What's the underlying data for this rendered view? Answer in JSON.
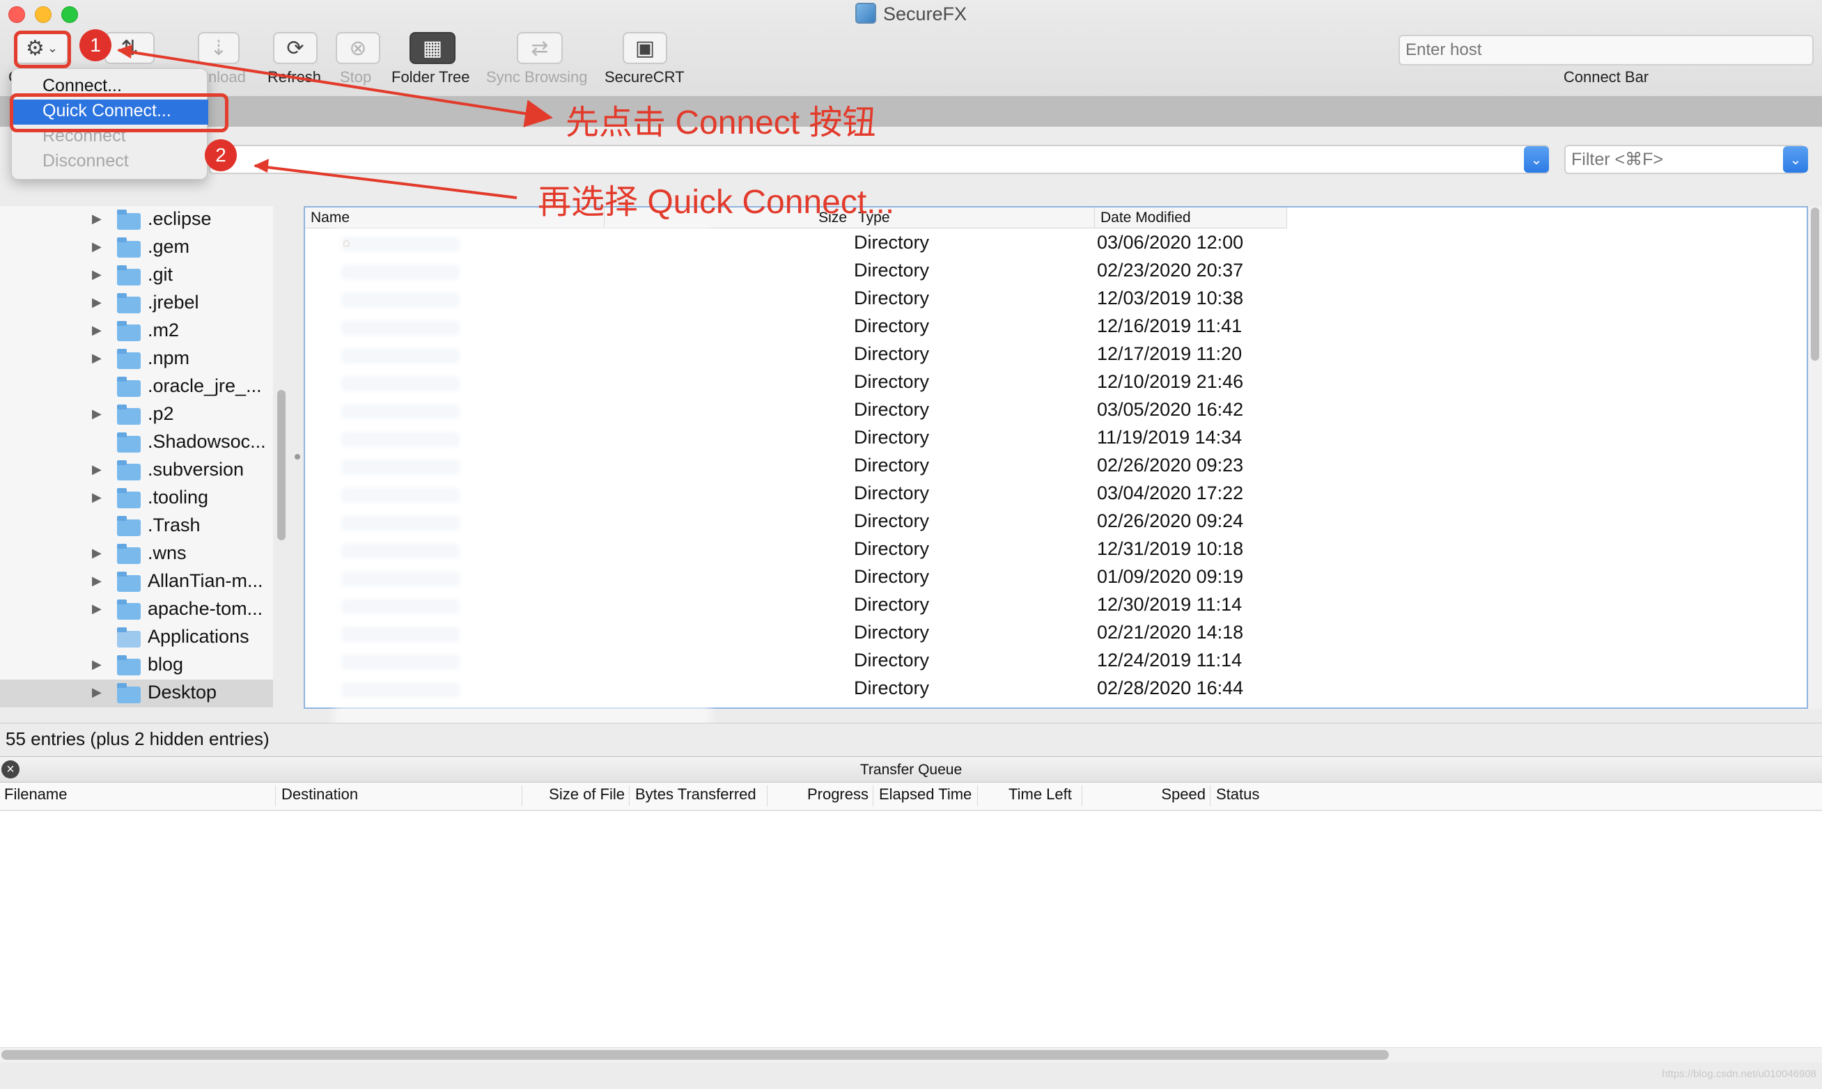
{
  "window": {
    "title": "SecureFX"
  },
  "toolbar": {
    "connect_partial_label": "C",
    "download_label": "Download",
    "download_partial": "vnload",
    "refresh_label": "Refresh",
    "stop_label": "Stop",
    "folder_tree_label": "Folder Tree",
    "sync_browsing_label": "Sync Browsing",
    "securecrt_label": "SecureCRT",
    "host_placeholder": "Enter host",
    "connect_bar_label": "Connect Bar"
  },
  "connect_menu": {
    "items": [
      {
        "label": "Connect...",
        "state": "normal"
      },
      {
        "label": "Quick Connect...",
        "state": "highlighted"
      },
      {
        "label": "Reconnect",
        "state": "disabled"
      },
      {
        "label": "Disconnect",
        "state": "disabled"
      }
    ]
  },
  "filter": {
    "placeholder": "Filter <⌘F>"
  },
  "annotations": {
    "badge1": "1",
    "badge2": "2",
    "step1_text": "先点击 Connect 按钮",
    "step2_text": "再选择 Quick Connect...",
    "color": "#e23a2b"
  },
  "folder_tree": {
    "items": [
      {
        "label": ".eclipse",
        "expandable": true
      },
      {
        "label": ".gem",
        "expandable": true
      },
      {
        "label": ".git",
        "expandable": true
      },
      {
        "label": ".jrebel",
        "expandable": true
      },
      {
        "label": ".m2",
        "expandable": true
      },
      {
        "label": ".npm",
        "expandable": true
      },
      {
        "label": ".oracle_jre_...",
        "expandable": false
      },
      {
        "label": ".p2",
        "expandable": true
      },
      {
        "label": ".Shadowsoc...",
        "expandable": false
      },
      {
        "label": ".subversion",
        "expandable": true
      },
      {
        "label": ".tooling",
        "expandable": true
      },
      {
        "label": ".Trash",
        "expandable": false
      },
      {
        "label": ".wns",
        "expandable": true
      },
      {
        "label": "AllanTian-m...",
        "expandable": true
      },
      {
        "label": "apache-tom...",
        "expandable": true
      },
      {
        "label": "Applications",
        "expandable": false
      },
      {
        "label": "blog",
        "expandable": true
      },
      {
        "label": "Desktop",
        "expandable": true,
        "selected": true
      }
    ]
  },
  "file_list": {
    "columns": {
      "name": "Name",
      "size": "Size",
      "type": "Type",
      "date": "Date Modified"
    },
    "rows": [
      {
        "type": "Directory",
        "date": "03/06/2020 12:00"
      },
      {
        "type": "Directory",
        "date": "02/23/2020 20:37"
      },
      {
        "type": "Directory",
        "date": "12/03/2019 10:38"
      },
      {
        "type": "Directory",
        "date": "12/16/2019 11:41"
      },
      {
        "type": "Directory",
        "date": "12/17/2019 11:20"
      },
      {
        "type": "Directory",
        "date": "12/10/2019 21:46"
      },
      {
        "type": "Directory",
        "date": "03/05/2020 16:42"
      },
      {
        "type": "Directory",
        "date": "11/19/2019 14:34"
      },
      {
        "type": "Directory",
        "date": "02/26/2020 09:23"
      },
      {
        "type": "Directory",
        "date": "03/04/2020 17:22"
      },
      {
        "type": "Directory",
        "date": "02/26/2020 09:24"
      },
      {
        "type": "Directory",
        "date": "12/31/2019 10:18"
      },
      {
        "type": "Directory",
        "date": "01/09/2020 09:19"
      },
      {
        "type": "Directory",
        "date": "12/30/2019 11:14"
      },
      {
        "type": "Directory",
        "date": "02/21/2020 14:18"
      },
      {
        "type": "Directory",
        "date": "12/24/2019 11:14"
      },
      {
        "type": "Directory",
        "date": "02/28/2020 16:44"
      }
    ]
  },
  "status": {
    "entries_text": "55 entries (plus 2 hidden entries)"
  },
  "transfer_queue": {
    "title": "Transfer Queue",
    "columns": {
      "filename": "Filename",
      "destination": "Destination",
      "size_of_file": "Size of File",
      "bytes_transferred": "Bytes Transferred",
      "progress": "Progress",
      "elapsed_time": "Elapsed Time",
      "time_left": "Time Left",
      "speed": "Speed",
      "status": "Status"
    }
  },
  "watermark": "https://blog.csdn.net/u010046908"
}
